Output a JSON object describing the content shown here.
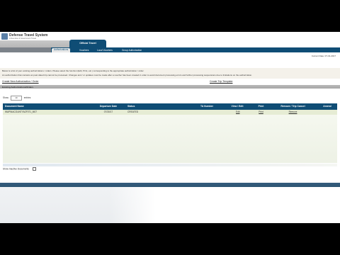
{
  "header": {
    "app_title": "Defense Travel System",
    "app_subtitle": "A New Era of Government Travel",
    "brand_tab": "Official Travel"
  },
  "nav": {
    "items": [
      {
        "label": "Authorizations",
        "active": true
      },
      {
        "label": "Vouchers",
        "active": false
      },
      {
        "label": "Local Vouchers",
        "active": false
      },
      {
        "label": "Group Authorization",
        "active": false
      }
    ]
  },
  "current_date": "Current Date: 07-31-2017",
  "message": {
    "line1": "Below is a list of your existing authorizations / orders. Please select the function (Edit, Print, etc.) corresponding to the appropriate authorization / order.",
    "line2": "An authorization that contains an past dated trip cannot be processed. Changes and / or updates must be made after a voucher has been created in order to avoid document processing errors and further processing suspensions due to limitations on the authorization."
  },
  "links": {
    "create_new": "Create New Authorization / Order",
    "create_template": "Create Trip Template"
  },
  "section_title": "Existing Authorizations/Orders",
  "show": {
    "label_before": "Show",
    "value": "10",
    "label_after": "entries"
  },
  "table": {
    "headers": [
      "Document Name",
      "Departure Date",
      "Status",
      "TA Number",
      "View / Edit",
      "Print",
      "Remove / Trip Cancel",
      "Amend"
    ],
    "rows": [
      {
        "document_name": "WAPINACOUNTYAZF071_M07",
        "departure_date": "07/30/17",
        "status": "CREATED",
        "ta_number": "",
        "view_edit": "Edit",
        "print": "Print",
        "remove": "Remove",
        "amend": ""
      }
    ]
  },
  "show_inactive": "Show Inactive Documents",
  "colors": {
    "brand_blue": "#0f4d75",
    "row_green": "#e6ecd4",
    "message_bg": "#f4f1ea"
  }
}
